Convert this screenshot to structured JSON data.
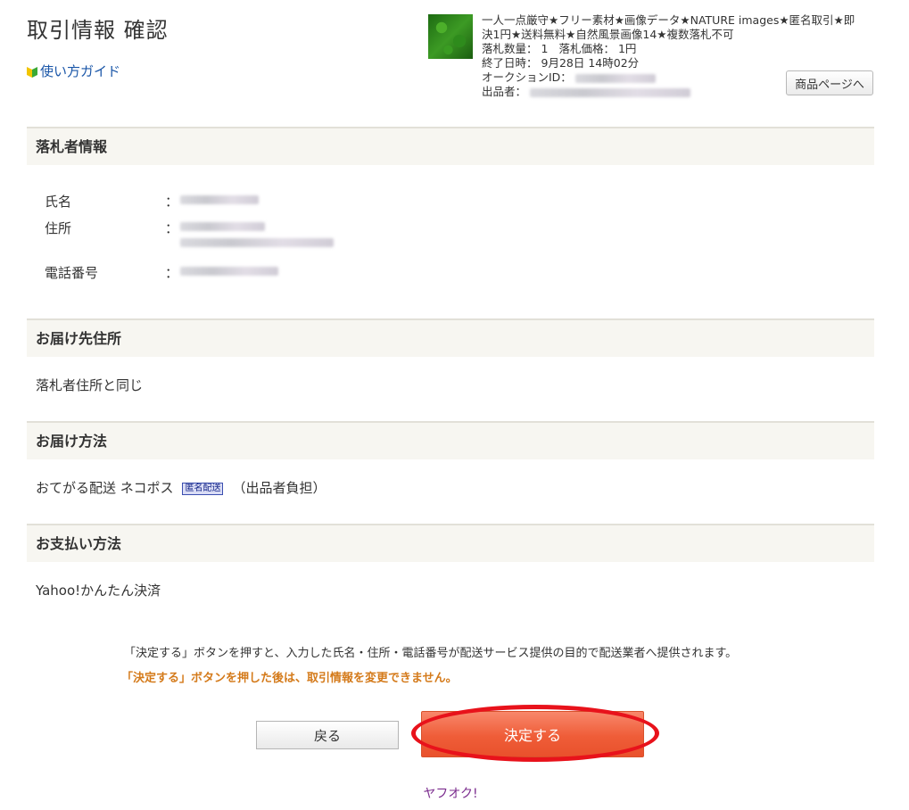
{
  "header": {
    "title": "取引情報 確認",
    "guide_link": "使い方ガイド"
  },
  "item": {
    "title_line1": "一人一点厳守★フリー素材★画像データ★NATURE images★匿名取引★即",
    "title_line2": "決1円★送料無料★自然風景画像14★複数落札不可",
    "quantity_label": "落札数量：",
    "quantity": "1",
    "price_label": "落札価格：",
    "price": "1円",
    "end_label": "終了日時：",
    "end_time": "9月28日 14時02分",
    "auction_id_label": "オークションID：",
    "seller_label": "出品者：",
    "product_page_button": "商品ページへ"
  },
  "winner_section": {
    "heading": "落札者情報",
    "name_label": "氏名",
    "address_label": "住所",
    "phone_label": "電話番号",
    "colon": "："
  },
  "shipping_address_section": {
    "heading": "お届け先住所",
    "value": "落札者住所と同じ"
  },
  "shipping_method_section": {
    "heading": "お届け方法",
    "method": "おてがる配送 ネコポス",
    "badge": "匿名配送",
    "payer": "（出品者負担）"
  },
  "payment_section": {
    "heading": "お支払い方法",
    "value": "Yahoo!かんたん決済"
  },
  "notice": {
    "info": "「決定する」ボタンを押すと、入力した氏名・住所・電話番号が配送サービス提供の目的で配送業者へ提供されます。",
    "warning": "「決定する」ボタンを押した後は、取引情報を変更できません。"
  },
  "actions": {
    "back_button": "戻る",
    "confirm_button": "決定する"
  },
  "footer": {
    "logo": "ヤフオク!"
  },
  "colors": {
    "link": "#1a56a8",
    "warning": "#d47a1a",
    "confirm_button": "#ef5d38",
    "highlight_ring": "#e8121b",
    "section_header_bg": "#f7f6f1",
    "footer_logo": "#7b2c8e"
  }
}
